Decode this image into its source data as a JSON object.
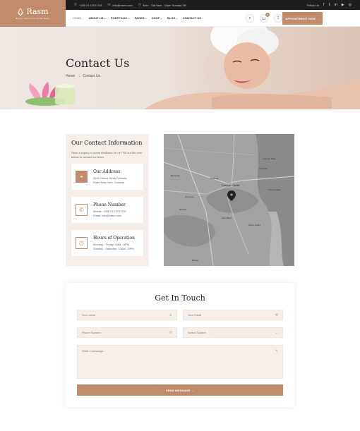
{
  "brand": {
    "name": "Rasm",
    "tagline": "Beauty Spa Center & Nail Salon"
  },
  "topbar": {
    "phone": "+255 214 203 215",
    "email": "Info@rasm.com",
    "hours": "Mon - Sat 9am - 10pm Sunday Off",
    "follow_label": "Follow Us",
    "social_icons": [
      "facebook-icon",
      "twitter-icon",
      "linkedin-icon",
      "youtube-icon",
      "instagram-icon"
    ]
  },
  "nav": {
    "items": [
      {
        "label": "HOME",
        "caret": "⌄"
      },
      {
        "label": "ABOUT US",
        "caret": "⌄"
      },
      {
        "label": "PORTFOLIO",
        "caret": "⌄"
      },
      {
        "label": "PAGES",
        "caret": "⌄"
      },
      {
        "label": "SHOP",
        "caret": "⌄"
      },
      {
        "label": "BLOG",
        "caret": "⌄"
      },
      {
        "label": "CONTACT US",
        "caret": ""
      }
    ],
    "cart_count": "0",
    "appointment_label": "APPOINTMENT NOW →"
  },
  "hero": {
    "title": "Contact Us",
    "breadcrumb_home": "Home",
    "breadcrumb_sep": "→",
    "breadcrumb_current": "Contact Us"
  },
  "info": {
    "title": "Our Contact Information",
    "intro": "Have a inquiry or some feedback for us? Fill out the form below to contact our team.",
    "address": {
      "title": "Our Address",
      "line1": "2690 Hilona Street Victoria",
      "line2": "Road New York, Canada"
    },
    "phone": {
      "title": "Phone Number",
      "mobile": "Mobile: +255 214 203 215",
      "email": "Email: info@rasm.com"
    },
    "hours": {
      "title": "Hours of Operation",
      "line1": "Monday - Friday: 9AM - 8PM",
      "line2": "Sunday - Saturday: 10AM - 6PM"
    }
  },
  "map": {
    "city_label": "Corpus Christi",
    "labels": [
      "Portland",
      "Ingleside",
      "Aransas Pass",
      "Port Aransas",
      "Padre Island",
      "Flour Bluff",
      "Robstown",
      "Banquete",
      "Driscoll",
      "Bishop"
    ]
  },
  "form": {
    "title": "Get In Touch",
    "name_placeholder": "Your name",
    "email_placeholder": "Your Email",
    "phone_placeholder": "Phone Number",
    "subject_placeholder": "Select Subject",
    "message_placeholder": "Write a message...",
    "send_label": "SEND MESSAGE →"
  },
  "colors": {
    "accent": "#c08c6c",
    "cream": "#f6efe9",
    "dark": "#1e1e1e"
  }
}
